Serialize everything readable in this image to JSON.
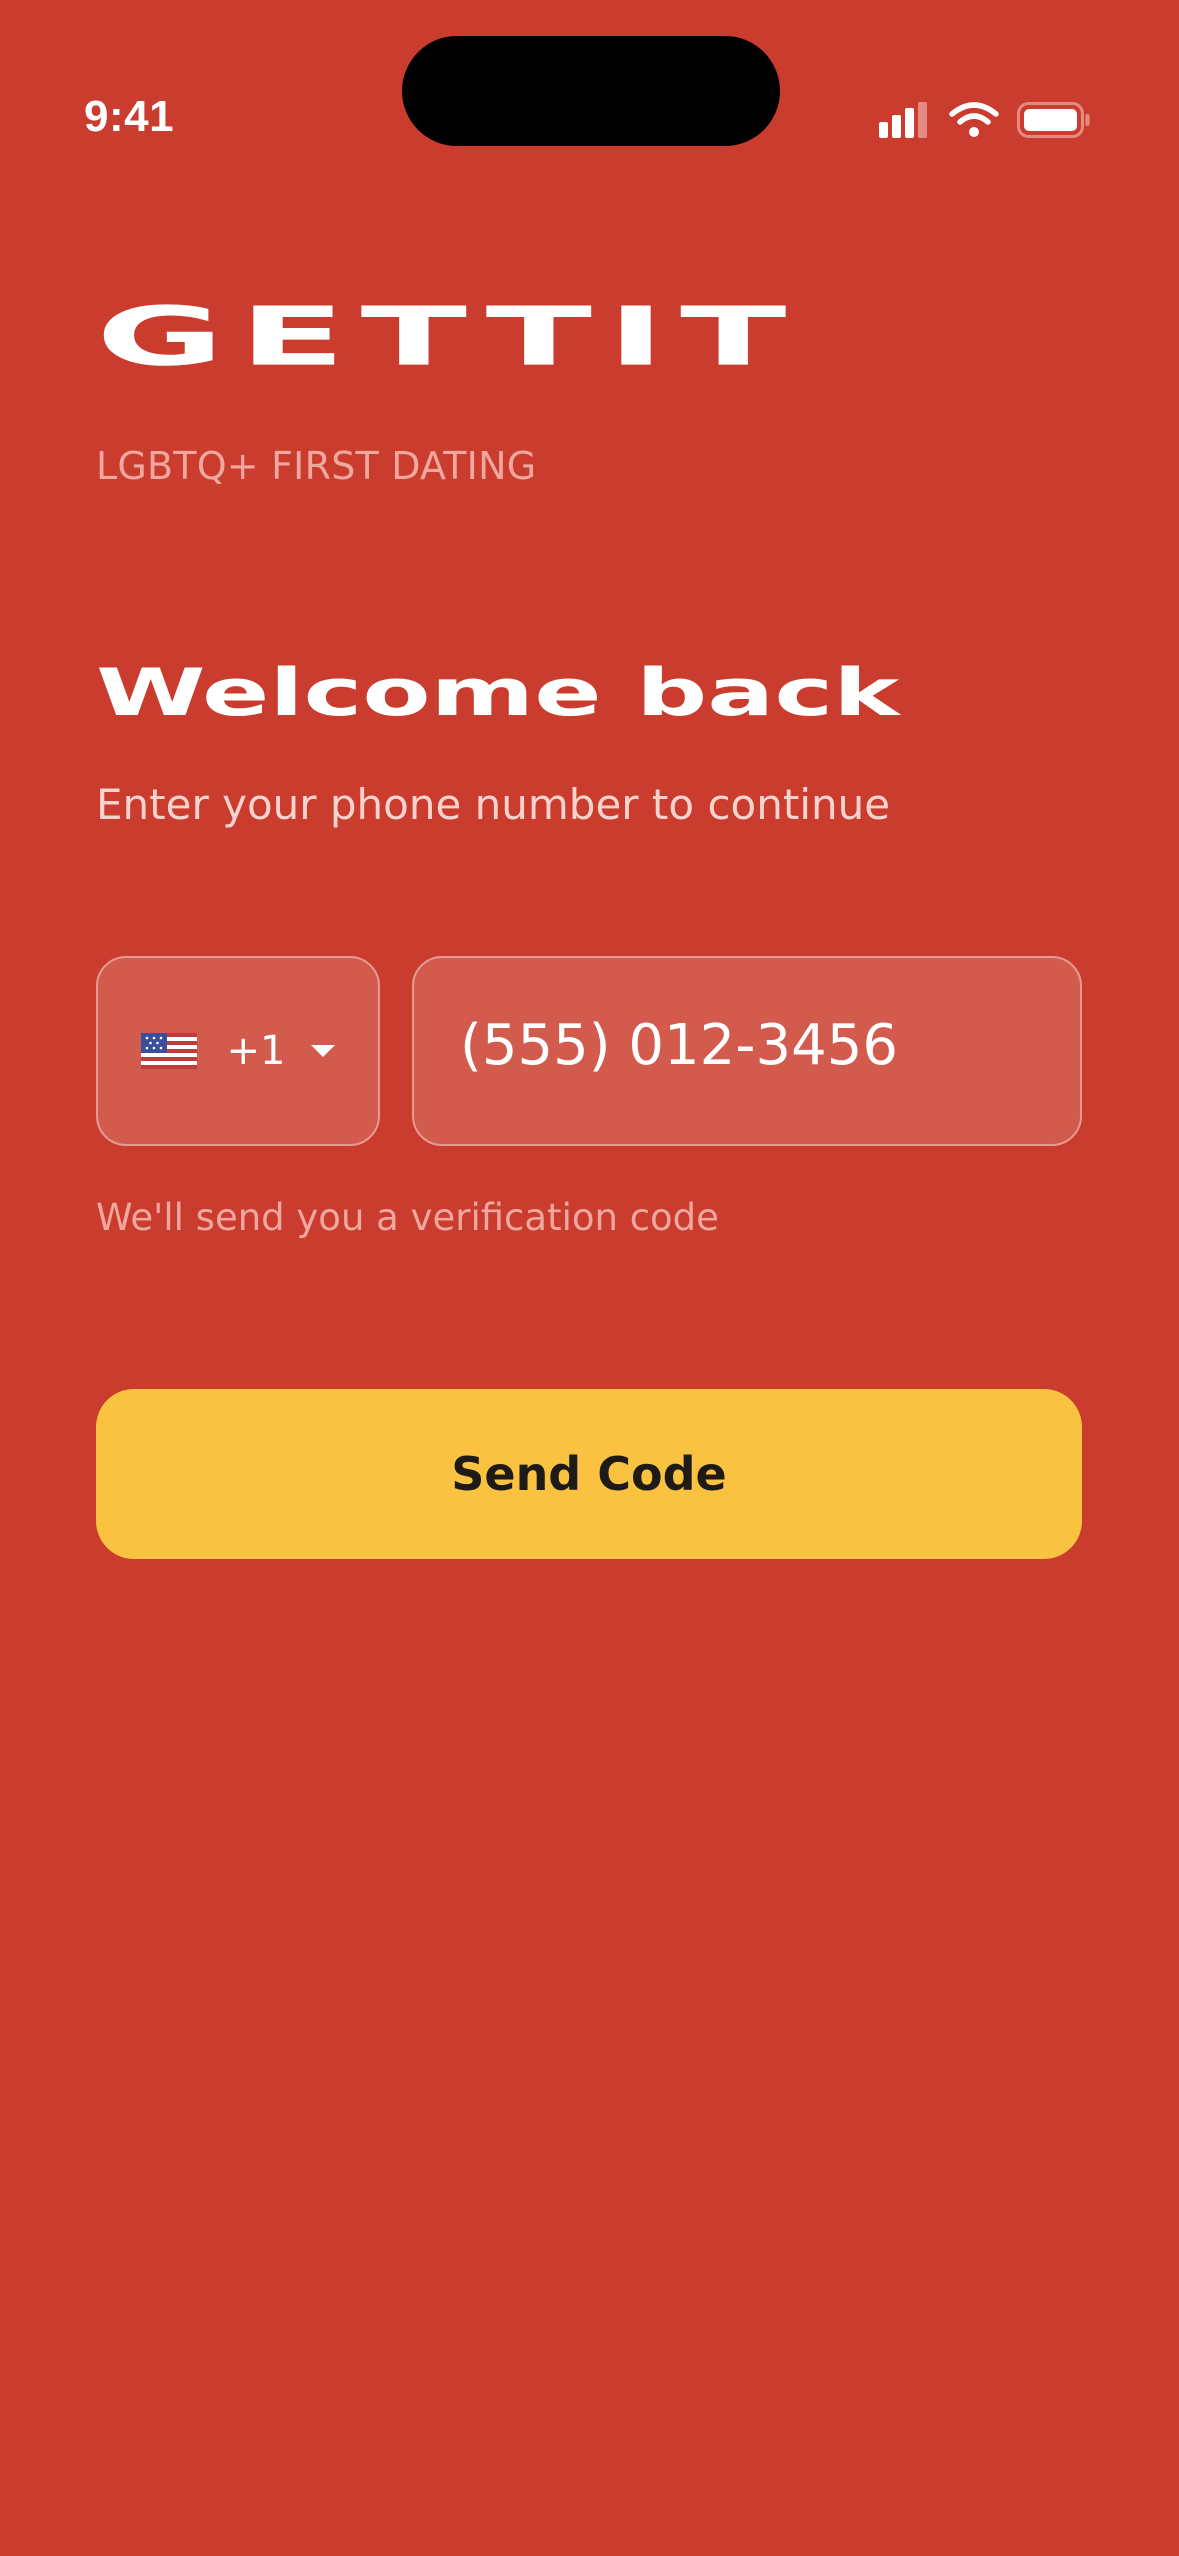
{
  "status_bar": {
    "time": "9:41",
    "signal_icon": "signal-bars-icon",
    "wifi_icon": "wifi-icon",
    "battery_icon": "battery-icon"
  },
  "brand": {
    "name": "GETTIT",
    "tagline": "LGBTQ+ FIRST DATING"
  },
  "login": {
    "heading": "Welcome back",
    "subtitle": "Enter your phone number to continue",
    "country": {
      "flag_icon": "us-flag-icon",
      "code": "+1"
    },
    "phone": {
      "value": "(555) 012-3456"
    },
    "helper": "We'll send you a verification code",
    "submit_label": "Send Code"
  },
  "colors": {
    "background": "#C93C2E",
    "accent_button": "#FAC241",
    "input_fill": "#D35B4E",
    "input_border": "#E49A90",
    "muted_text": "#F0A79E"
  }
}
